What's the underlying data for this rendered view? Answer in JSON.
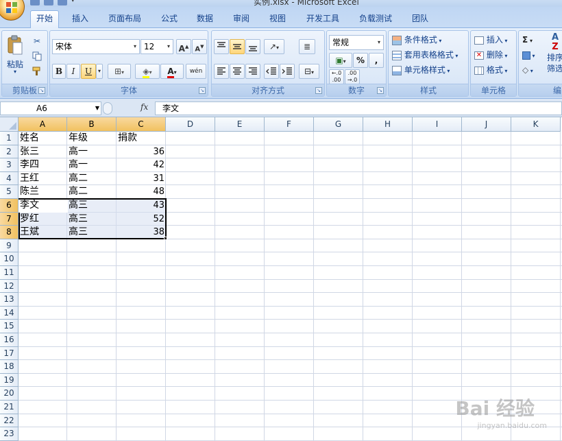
{
  "window": {
    "title": "实例.xlsx - Microsoft Excel"
  },
  "tabs": [
    "开始",
    "插入",
    "页面布局",
    "公式",
    "数据",
    "审阅",
    "视图",
    "开发工具",
    "负载测试",
    "团队"
  ],
  "ribbon": {
    "clipboard": {
      "label": "剪贴板",
      "paste": "粘贴"
    },
    "font": {
      "label": "字体",
      "name": "宋体",
      "size": "12",
      "bold": "B",
      "italic": "I",
      "underline": "U",
      "color_a": "A",
      "phonetic": "wén"
    },
    "alignment": {
      "label": "对齐方式"
    },
    "number": {
      "label": "数字",
      "format": "常规",
      "percent": "%",
      "comma": ","
    },
    "styles": {
      "label": "样式",
      "cond": "条件格式",
      "table": "套用表格格式",
      "cell": "单元格样式"
    },
    "cells": {
      "label": "单元格",
      "insert": "插入",
      "delete": "删除",
      "format": "格式"
    },
    "editing": {
      "label": "编",
      "sum": "Σ",
      "sort": "排序",
      "filter": "筛选"
    }
  },
  "formula_bar": {
    "name_box": "A6",
    "fx": "fx",
    "value": "李文"
  },
  "columns": [
    "A",
    "B",
    "C",
    "D",
    "E",
    "F",
    "G",
    "H",
    "I",
    "J",
    "K"
  ],
  "rows": [
    "1",
    "2",
    "3",
    "4",
    "5",
    "6",
    "7",
    "8",
    "9",
    "10",
    "11",
    "12",
    "13",
    "14",
    "15",
    "16",
    "17",
    "18",
    "19",
    "20",
    "21",
    "22",
    "23"
  ],
  "cells": [
    [
      "姓名",
      "年级",
      "捐款"
    ],
    [
      "张三",
      "高一",
      "36"
    ],
    [
      "李四",
      "高一",
      "42"
    ],
    [
      "王红",
      "高二",
      "31"
    ],
    [
      "陈兰",
      "高二",
      "48"
    ],
    [
      "李文",
      "高三",
      "43"
    ],
    [
      "罗红",
      "高三",
      "52"
    ],
    [
      "王斌",
      "高三",
      "38"
    ]
  ],
  "watermark": {
    "text": "Bai 经验",
    "url": "jingyan.baidu.com"
  }
}
